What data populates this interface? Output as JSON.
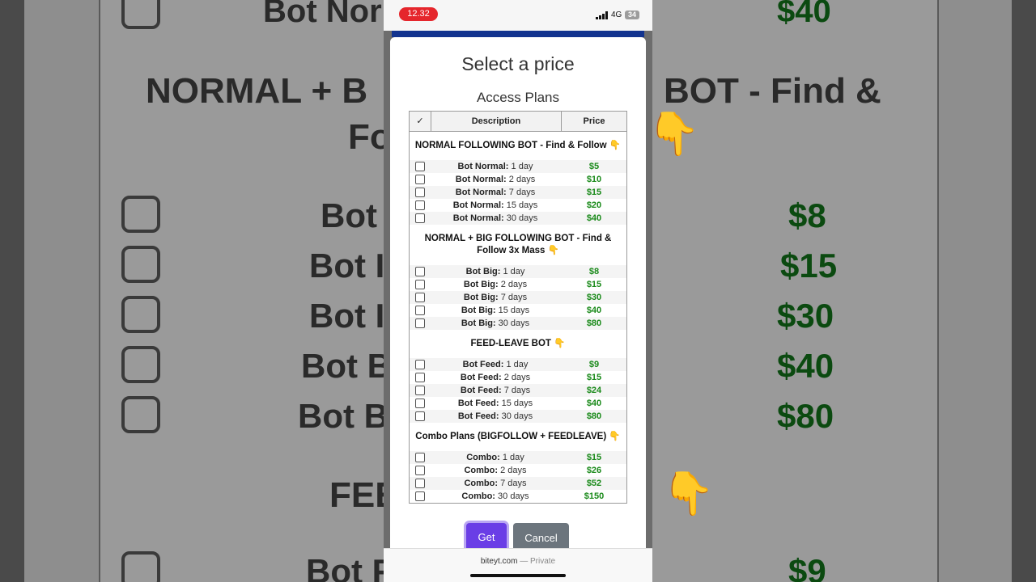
{
  "status_bar": {
    "time": "12.32",
    "network": "4G",
    "battery": "34"
  },
  "modal": {
    "title": "Select a price",
    "section": "Access Plans",
    "table_headers": {
      "check": "✓",
      "description": "Description",
      "price": "Price"
    },
    "groups": [
      {
        "title": "NORMAL FOLLOWING BOT - Find & Follow 👇",
        "rows": [
          {
            "name": "Bot Normal:",
            "duration": "1 day",
            "price": "$5"
          },
          {
            "name": "Bot Normal:",
            "duration": "2 days",
            "price": "$10"
          },
          {
            "name": "Bot Normal:",
            "duration": "7 days",
            "price": "$15"
          },
          {
            "name": "Bot Normal:",
            "duration": "15 days",
            "price": "$20"
          },
          {
            "name": "Bot Normal:",
            "duration": "30 days",
            "price": "$40"
          }
        ]
      },
      {
        "title_line1": "NORMAL + BIG FOLLOWING BOT - Find &",
        "title_line2": "Follow 3x Mass 👇",
        "rows": [
          {
            "name": "Bot Big:",
            "duration": "1 day",
            "price": "$8"
          },
          {
            "name": "Bot Big:",
            "duration": "2 days",
            "price": "$15"
          },
          {
            "name": "Bot Big:",
            "duration": "7 days",
            "price": "$30"
          },
          {
            "name": "Bot Big:",
            "duration": "15 days",
            "price": "$40"
          },
          {
            "name": "Bot Big:",
            "duration": "30 days",
            "price": "$80"
          }
        ]
      },
      {
        "title": "FEED-LEAVE BOT 👇",
        "rows": [
          {
            "name": "Bot Feed:",
            "duration": "1 day",
            "price": "$9"
          },
          {
            "name": "Bot Feed:",
            "duration": "2 days",
            "price": "$15"
          },
          {
            "name": "Bot Feed:",
            "duration": "7 days",
            "price": "$24"
          },
          {
            "name": "Bot Feed:",
            "duration": "15 days",
            "price": "$40"
          },
          {
            "name": "Bot Feed:",
            "duration": "30 days",
            "price": "$80"
          }
        ]
      },
      {
        "title": "Combo Plans (BIGFOLLOW + FEEDLEAVE) 👇",
        "rows": [
          {
            "name": "Combo:",
            "duration": "1 day",
            "price": "$15"
          },
          {
            "name": "Combo:",
            "duration": "2 days",
            "price": "$26"
          },
          {
            "name": "Combo:",
            "duration": "7 days",
            "price": "$52"
          },
          {
            "name": "Combo:",
            "duration": "30 days",
            "price": "$150"
          }
        ]
      }
    ],
    "buttons": {
      "get": "Get",
      "cancel": "Cancel"
    }
  },
  "browser": {
    "domain": "biteyt.com",
    "separator": "—",
    "mode": "Private"
  },
  "background": {
    "top_label": "Bot Nor",
    "top_price": "$40",
    "heading_left": "NORMAL + B",
    "heading_right": "BOT - Find &",
    "heading_line2": "Fo",
    "rows": [
      {
        "label": "Bot",
        "price": "$8"
      },
      {
        "label": "Bot I",
        "price": "$15"
      },
      {
        "label": "Bot I",
        "price": "$30"
      },
      {
        "label": "Bot B",
        "price": "$40"
      },
      {
        "label": "Bot B",
        "price": "$80"
      }
    ],
    "fee_label": "FEE",
    "bottom_label": "Bot F",
    "bottom_price": "$9",
    "colors": {
      "price_green": "#1a8a1a",
      "get_button": "#6a3ee6",
      "cancel_button": "#6c757d",
      "time_pill": "#e5262c"
    }
  }
}
